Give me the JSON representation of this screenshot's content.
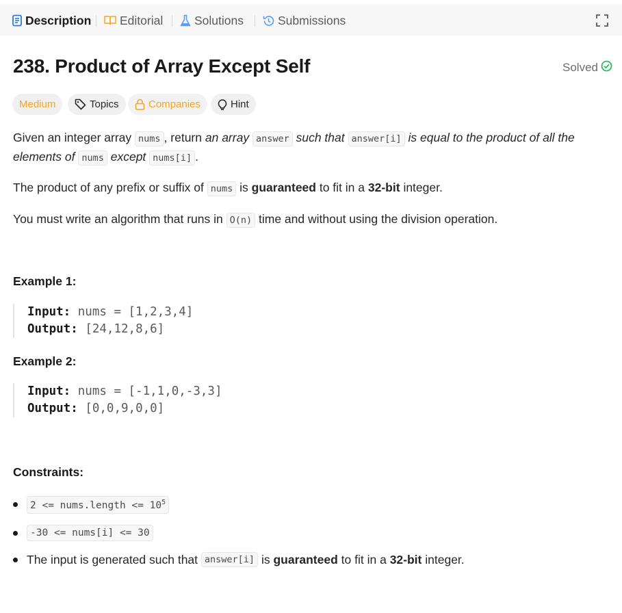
{
  "tabs": {
    "description": "Description",
    "editorial": "Editorial",
    "solutions": "Solutions",
    "submissions": "Submissions"
  },
  "problem": {
    "title": "238. Product of Array Except Self",
    "status": "Solved",
    "difficulty": "Medium",
    "chips": {
      "topics": "Topics",
      "companies": "Companies",
      "hint": "Hint"
    }
  },
  "description": {
    "p1": {
      "t1": "Given an integer array",
      "c1": "nums",
      "t2": ", return",
      "i1": "an array",
      "c2": "answer",
      "i2": "such that",
      "c3": "answer[i]",
      "i3": "is equal to the product of all the",
      "i4": "elements of",
      "c4": "nums",
      "i5": "except",
      "c5": "nums[i]",
      "t3": "."
    },
    "p2": {
      "t1": "The product of any prefix or suffix of",
      "c1": "nums",
      "t2": "is",
      "b1": "guaranteed",
      "t3": "to fit in a",
      "b2": "32-bit",
      "t4": "integer."
    },
    "p3": {
      "t1": "You must write an algorithm that runs in",
      "c1": "O(n)",
      "t2": "time and without using the division operation."
    }
  },
  "examples": [
    {
      "heading": "Example 1:",
      "input_label": "Input:",
      "input": "nums = [1,2,3,4]",
      "output_label": "Output:",
      "output": "[24,12,8,6]"
    },
    {
      "heading": "Example 2:",
      "input_label": "Input:",
      "input": "nums = [-1,1,0,-3,3]",
      "output_label": "Output:",
      "output": "[0,0,9,0,0]"
    }
  ],
  "constraints": {
    "heading": "Constraints:",
    "c1": {
      "code": "2 <= nums.length <= 10",
      "sup": "5"
    },
    "c2": {
      "code": "-30 <= nums[i] <= 30"
    },
    "c3": {
      "t1": "The input is generated such that",
      "code": "answer[i]",
      "t2": "is",
      "b1": "guaranteed",
      "t3": "to fit in a",
      "b2": "32-bit",
      "t4": "integer."
    }
  },
  "colors": {
    "medium": "#f5a623",
    "solved": "#2cbb5d",
    "description_icon": "#2a7ae2",
    "solutions_icon": "#5b9cf5"
  },
  "icons": [
    "description-icon",
    "editorial-book-icon",
    "solutions-flask-icon",
    "submissions-history-icon",
    "fullscreen-icon",
    "solved-check-icon",
    "tag-icon",
    "lock-icon",
    "lightbulb-icon"
  ]
}
